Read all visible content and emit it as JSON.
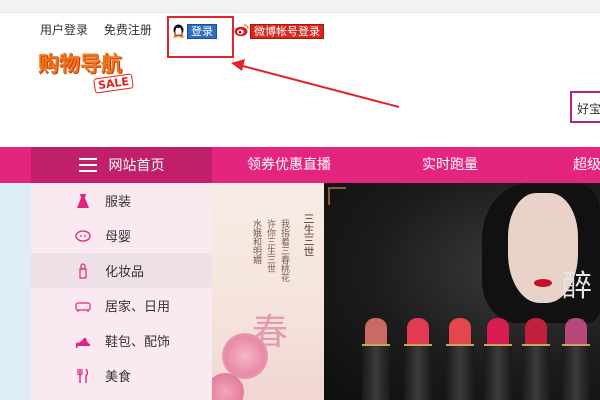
{
  "header": {
    "links": [
      "用户登录",
      "免费注册"
    ],
    "qq_login_label": "登录",
    "weibo_login_label": "微博帐号登录"
  },
  "logo": {
    "text": "购物导航",
    "badge": "SALE"
  },
  "search": {
    "value": "好宝"
  },
  "nav": {
    "home_label": "网站首页",
    "items": [
      "领券优惠直播",
      "实时跑量",
      "超级"
    ]
  },
  "sidebar": {
    "items": [
      {
        "label": "服装",
        "icon": "dress-icon"
      },
      {
        "label": "母婴",
        "icon": "baby-icon"
      },
      {
        "label": "化妆品",
        "icon": "lipstick-icon"
      },
      {
        "label": "居家、日用",
        "icon": "sofa-icon"
      },
      {
        "label": "鞋包、配饰",
        "icon": "high-heel-icon"
      },
      {
        "label": "美食",
        "icon": "fork-knife-icon"
      }
    ]
  },
  "banner": {
    "poem_lines": [
      "我指着三春桃花",
      "许你三生三世",
      "水娥和明媚"
    ],
    "title_vertical": "三生三世",
    "chun": "春",
    "zui": "醉"
  },
  "colors": {
    "nav_bg": "#e4257f",
    "nav_home_bg": "#c01f69",
    "sidebar_bg": "#fbe9f1",
    "annotation_red": "#e0262c"
  }
}
